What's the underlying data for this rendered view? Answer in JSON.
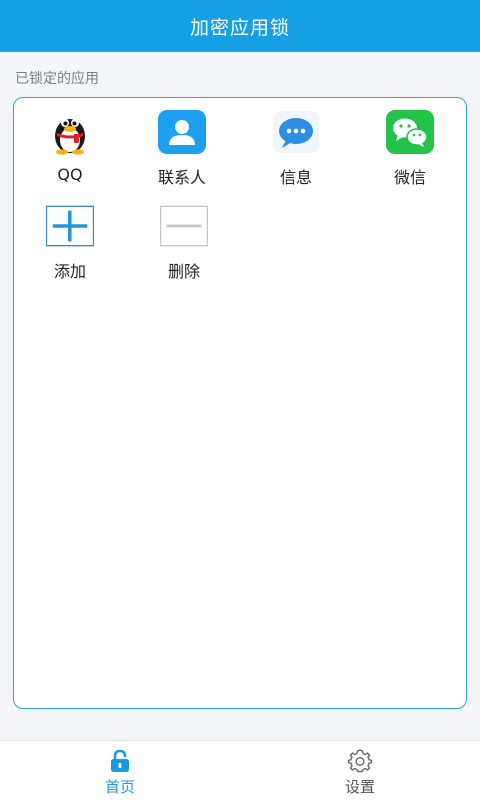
{
  "header": {
    "title": "加密应用锁"
  },
  "section": {
    "title": "已锁定的应用"
  },
  "apps": [
    {
      "label": "QQ",
      "icon": "qq-penguin-icon"
    },
    {
      "label": "联系人",
      "icon": "contacts-icon"
    },
    {
      "label": "信息",
      "icon": "messages-icon"
    },
    {
      "label": "微信",
      "icon": "wechat-icon"
    }
  ],
  "actions": [
    {
      "label": "添加",
      "icon": "plus-icon"
    },
    {
      "label": "删除",
      "icon": "minus-icon"
    }
  ],
  "nav": {
    "home": {
      "label": "首页",
      "icon": "lock-icon",
      "active": true
    },
    "settings": {
      "label": "设置",
      "icon": "gear-icon",
      "active": false
    }
  },
  "colors": {
    "accent": "#15a0e4",
    "panel_border": "#2ba3dc",
    "nav_active": "#1a9be0"
  }
}
